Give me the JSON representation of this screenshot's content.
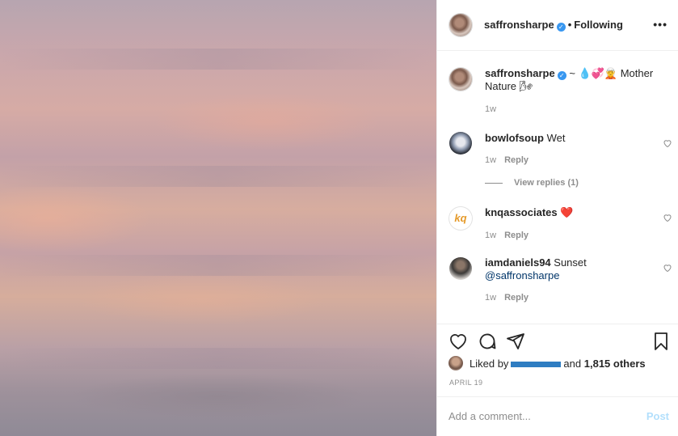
{
  "post": {
    "username": "saffronsharpe",
    "follow_status": "Following",
    "separator": "•",
    "more_label": "•••",
    "caption_prefix": "~ 💧💞🧝",
    "caption_text": "Mother Nature 🌬",
    "caption_time": "1w"
  },
  "comments": [
    {
      "user": "bowlofsoup",
      "text": "Wet",
      "time": "1w",
      "reply": "Reply",
      "view_replies": "View replies (1)"
    },
    {
      "user": "knqassociates",
      "text": "❤️",
      "time": "1w",
      "reply": "Reply",
      "avatar_text": "kq"
    },
    {
      "user": "iamdaniels94",
      "text": "Sunset",
      "mention": "@saffronsharpe",
      "time": "1w",
      "reply": "Reply"
    }
  ],
  "likes": {
    "prefix": "Liked by",
    "middle": "and",
    "count_text": "1,815 others"
  },
  "date": "APRIL 19",
  "add_comment": {
    "placeholder": "Add a comment...",
    "post_label": "Post"
  },
  "colors": {
    "verified": "#3897f0",
    "post_disabled": "#b2dffc",
    "mention": "#003569"
  }
}
